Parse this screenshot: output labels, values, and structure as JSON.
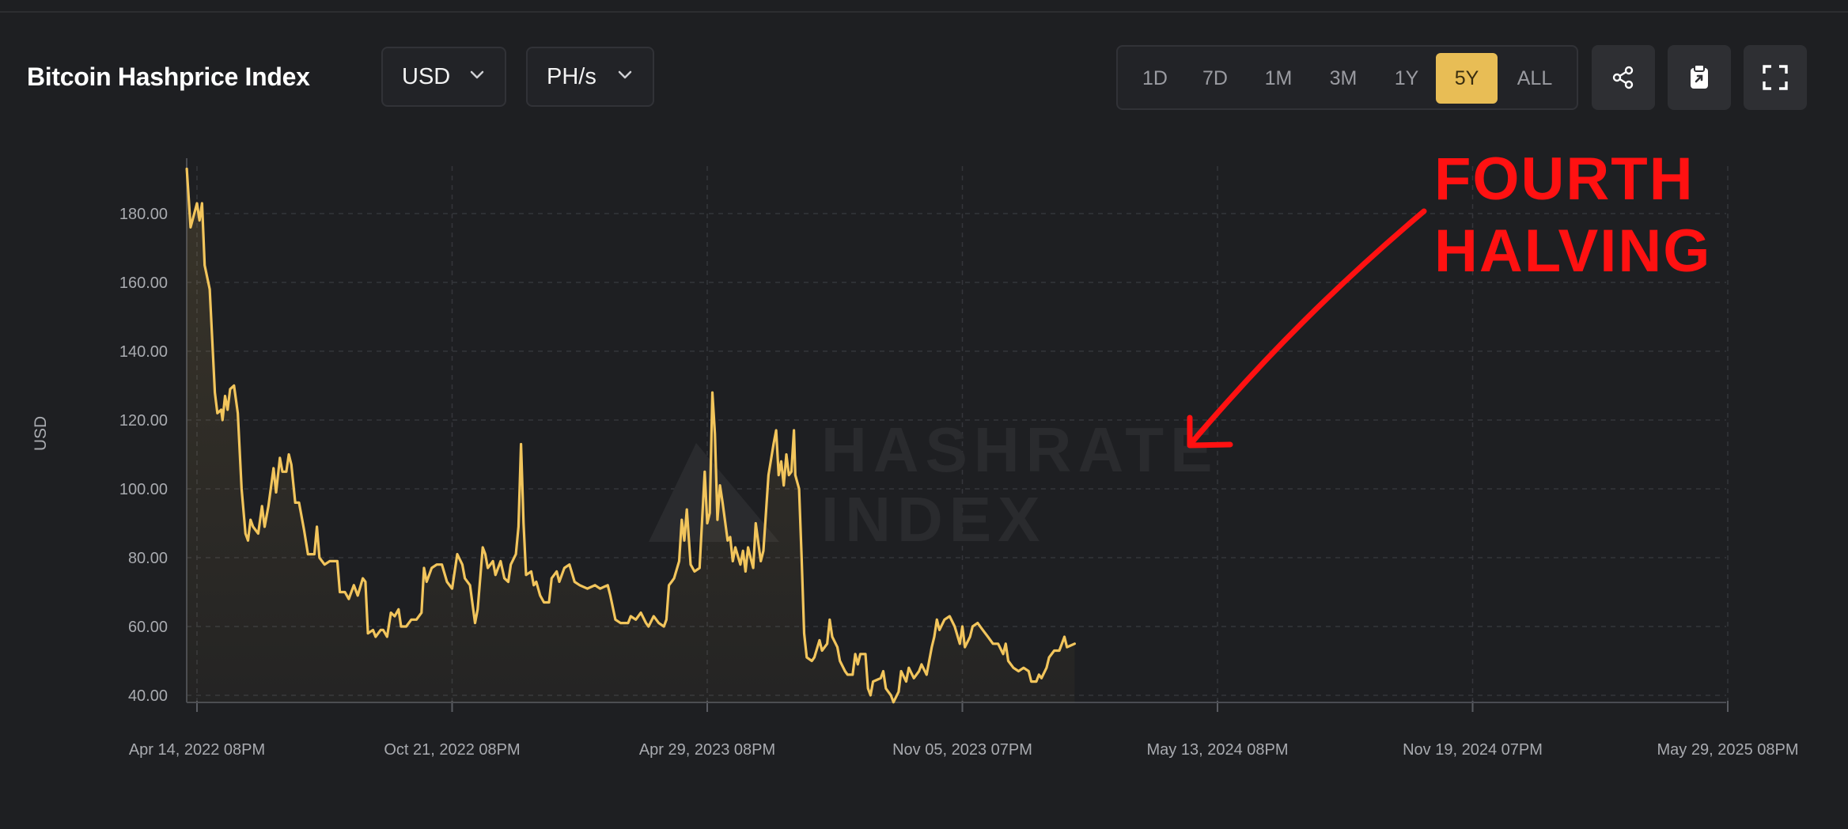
{
  "header": {
    "title": "Bitcoin Hashprice Index",
    "currency_label": "USD",
    "unit_label": "PH/s",
    "ranges": [
      "1D",
      "7D",
      "1M",
      "3M",
      "1Y",
      "5Y",
      "ALL"
    ],
    "active_range": "5Y",
    "icons": [
      "share-icon",
      "clipboard-icon",
      "fullscreen-icon"
    ]
  },
  "colors": {
    "background": "#1e1f22",
    "line": "#f2c55c",
    "accent": "#e8bd55",
    "annotation": "#ff1111"
  },
  "chart_data": {
    "type": "area",
    "ylabel": "USD",
    "ylim": [
      40,
      195
    ],
    "y_ticks": [
      "40.00",
      "60.00",
      "80.00",
      "100.00",
      "120.00",
      "140.00",
      "160.00",
      "180.00"
    ],
    "x_ticks": [
      "Apr 14, 2022 08PM",
      "Oct 21, 2022 08PM",
      "Apr 29, 2023 08PM",
      "Nov 05, 2023 07PM",
      "May 13, 2024 08PM",
      "Nov 19, 2024 07PM",
      "May 29, 2025 08PM"
    ],
    "grid": true,
    "watermark": [
      "HASHRATE",
      "INDEX"
    ],
    "annotation": {
      "lines": [
        "FOURTH",
        "HALVING"
      ]
    },
    "series": [
      {
        "values": [
          [
            -0.04,
            193
          ],
          [
            -0.025,
            176
          ],
          [
            0.0,
            183
          ],
          [
            0.01,
            178
          ],
          [
            0.02,
            183
          ],
          [
            0.03,
            165
          ],
          [
            0.05,
            158
          ],
          [
            0.07,
            128
          ],
          [
            0.08,
            122
          ],
          [
            0.095,
            123
          ],
          [
            0.1,
            120
          ],
          [
            0.11,
            127
          ],
          [
            0.12,
            123
          ],
          [
            0.13,
            129
          ],
          [
            0.145,
            130
          ],
          [
            0.16,
            122
          ],
          [
            0.175,
            100
          ],
          [
            0.19,
            87
          ],
          [
            0.2,
            85
          ],
          [
            0.21,
            91
          ],
          [
            0.22,
            89
          ],
          [
            0.24,
            87
          ],
          [
            0.255,
            95
          ],
          [
            0.265,
            89
          ],
          [
            0.28,
            95
          ],
          [
            0.3,
            106
          ],
          [
            0.31,
            99
          ],
          [
            0.325,
            109
          ],
          [
            0.335,
            105
          ],
          [
            0.35,
            105
          ],
          [
            0.36,
            110
          ],
          [
            0.37,
            107
          ],
          [
            0.385,
            96
          ],
          [
            0.4,
            96
          ],
          [
            0.42,
            88
          ],
          [
            0.435,
            81
          ],
          [
            0.46,
            81
          ],
          [
            0.47,
            89
          ],
          [
            0.48,
            80
          ],
          [
            0.5,
            78
          ],
          [
            0.52,
            79
          ],
          [
            0.55,
            79
          ],
          [
            0.56,
            70
          ],
          [
            0.58,
            70
          ],
          [
            0.595,
            68
          ],
          [
            0.615,
            72
          ],
          [
            0.63,
            69
          ],
          [
            0.65,
            74
          ],
          [
            0.66,
            73
          ],
          [
            0.67,
            58
          ],
          [
            0.69,
            59
          ],
          [
            0.7,
            57
          ],
          [
            0.72,
            59
          ],
          [
            0.73,
            59
          ],
          [
            0.745,
            57
          ],
          [
            0.76,
            64
          ],
          [
            0.775,
            63
          ],
          [
            0.79,
            65
          ],
          [
            0.8,
            60
          ],
          [
            0.82,
            60
          ],
          [
            0.84,
            62
          ],
          [
            0.86,
            62
          ],
          [
            0.88,
            64
          ],
          [
            0.89,
            77
          ],
          [
            0.9,
            73
          ],
          [
            0.92,
            77
          ],
          [
            0.94,
            78
          ],
          [
            0.96,
            78
          ],
          [
            0.98,
            73
          ],
          [
            1.0,
            71
          ],
          [
            1.02,
            81
          ],
          [
            1.04,
            78
          ],
          [
            1.05,
            74
          ],
          [
            1.07,
            72
          ],
          [
            1.09,
            61
          ],
          [
            1.1,
            65
          ],
          [
            1.12,
            83
          ],
          [
            1.13,
            81
          ],
          [
            1.14,
            77
          ],
          [
            1.16,
            79
          ],
          [
            1.17,
            75
          ],
          [
            1.19,
            79
          ],
          [
            1.205,
            74
          ],
          [
            1.22,
            73
          ],
          [
            1.23,
            78
          ],
          [
            1.25,
            81
          ],
          [
            1.26,
            89
          ],
          [
            1.27,
            113
          ],
          [
            1.28,
            90
          ],
          [
            1.29,
            75
          ],
          [
            1.31,
            76
          ],
          [
            1.32,
            72
          ],
          [
            1.33,
            73
          ],
          [
            1.345,
            69
          ],
          [
            1.36,
            67
          ],
          [
            1.38,
            67
          ],
          [
            1.39,
            74
          ],
          [
            1.41,
            76
          ],
          [
            1.42,
            73
          ],
          [
            1.44,
            77
          ],
          [
            1.46,
            78
          ],
          [
            1.48,
            73
          ],
          [
            1.5,
            72
          ],
          [
            1.53,
            71
          ],
          [
            1.56,
            72
          ],
          [
            1.58,
            71
          ],
          [
            1.61,
            72
          ],
          [
            1.62,
            69
          ],
          [
            1.64,
            62
          ],
          [
            1.66,
            61
          ],
          [
            1.69,
            61
          ],
          [
            1.7,
            63
          ],
          [
            1.72,
            62
          ],
          [
            1.74,
            64
          ],
          [
            1.76,
            61
          ],
          [
            1.77,
            60
          ],
          [
            1.79,
            63
          ],
          [
            1.81,
            61
          ],
          [
            1.83,
            60
          ],
          [
            1.84,
            62
          ],
          [
            1.85,
            72
          ],
          [
            1.86,
            73
          ],
          [
            1.87,
            74
          ],
          [
            1.89,
            79
          ],
          [
            1.9,
            91
          ],
          [
            1.91,
            85
          ],
          [
            1.92,
            94
          ],
          [
            1.935,
            78
          ],
          [
            1.95,
            76
          ],
          [
            1.97,
            77
          ],
          [
            1.99,
            105
          ],
          [
            2.0,
            90
          ],
          [
            2.01,
            93
          ],
          [
            2.02,
            128
          ],
          [
            2.03,
            116
          ],
          [
            2.04,
            91
          ],
          [
            2.05,
            101
          ],
          [
            2.06,
            96
          ],
          [
            2.08,
            85
          ],
          [
            2.09,
            86
          ],
          [
            2.1,
            79
          ],
          [
            2.11,
            83
          ],
          [
            2.13,
            78
          ],
          [
            2.14,
            82
          ],
          [
            2.15,
            76
          ],
          [
            2.16,
            83
          ],
          [
            2.17,
            80
          ],
          [
            2.18,
            77
          ],
          [
            2.19,
            90
          ],
          [
            2.21,
            79
          ],
          [
            2.22,
            82
          ],
          [
            2.23,
            93
          ],
          [
            2.24,
            104
          ],
          [
            2.26,
            113
          ],
          [
            2.27,
            117
          ],
          [
            2.28,
            104
          ],
          [
            2.29,
            108
          ],
          [
            2.3,
            101
          ],
          [
            2.31,
            110
          ],
          [
            2.32,
            104
          ],
          [
            2.33,
            105
          ],
          [
            2.34,
            117
          ],
          [
            2.345,
            104
          ],
          [
            2.36,
            100
          ],
          [
            2.37,
            80
          ],
          [
            2.38,
            58
          ],
          [
            2.39,
            51
          ],
          [
            2.41,
            50
          ],
          [
            2.42,
            51
          ],
          [
            2.44,
            56
          ],
          [
            2.45,
            53
          ],
          [
            2.47,
            55
          ],
          [
            2.48,
            62
          ],
          [
            2.49,
            57
          ],
          [
            2.51,
            54
          ],
          [
            2.52,
            50
          ],
          [
            2.54,
            47
          ],
          [
            2.55,
            46
          ],
          [
            2.57,
            46
          ],
          [
            2.58,
            52
          ],
          [
            2.59,
            49
          ],
          [
            2.6,
            52
          ],
          [
            2.62,
            52
          ],
          [
            2.63,
            42
          ],
          [
            2.64,
            40
          ],
          [
            2.65,
            44
          ],
          [
            2.68,
            45
          ],
          [
            2.69,
            47
          ],
          [
            2.7,
            42
          ],
          [
            2.72,
            40
          ],
          [
            2.73,
            38
          ],
          [
            2.75,
            41
          ],
          [
            2.76,
            47
          ],
          [
            2.78,
            44
          ],
          [
            2.79,
            48
          ],
          [
            2.81,
            45
          ],
          [
            2.83,
            47
          ],
          [
            2.84,
            49
          ],
          [
            2.86,
            46
          ],
          [
            2.88,
            54
          ],
          [
            2.89,
            57
          ],
          [
            2.9,
            62
          ],
          [
            2.91,
            59
          ],
          [
            2.93,
            62
          ],
          [
            2.95,
            63
          ],
          [
            2.97,
            60
          ],
          [
            2.99,
            55
          ],
          [
            3.0,
            60
          ],
          [
            3.01,
            54
          ],
          [
            3.03,
            57
          ],
          [
            3.04,
            60
          ],
          [
            3.06,
            61
          ],
          [
            3.08,
            59
          ],
          [
            3.1,
            57
          ],
          [
            3.12,
            55
          ],
          [
            3.14,
            55
          ],
          [
            3.16,
            52
          ],
          [
            3.17,
            55
          ],
          [
            3.18,
            50
          ],
          [
            3.2,
            48
          ],
          [
            3.22,
            47
          ],
          [
            3.24,
            48
          ],
          [
            3.26,
            47
          ],
          [
            3.27,
            44
          ],
          [
            3.29,
            44
          ],
          [
            3.3,
            46
          ],
          [
            3.31,
            45
          ],
          [
            3.33,
            48
          ],
          [
            3.34,
            51
          ],
          [
            3.36,
            53
          ],
          [
            3.38,
            53
          ],
          [
            3.39,
            55
          ],
          [
            3.4,
            57
          ],
          [
            3.41,
            54
          ],
          [
            3.44,
            55
          ]
        ]
      }
    ]
  }
}
